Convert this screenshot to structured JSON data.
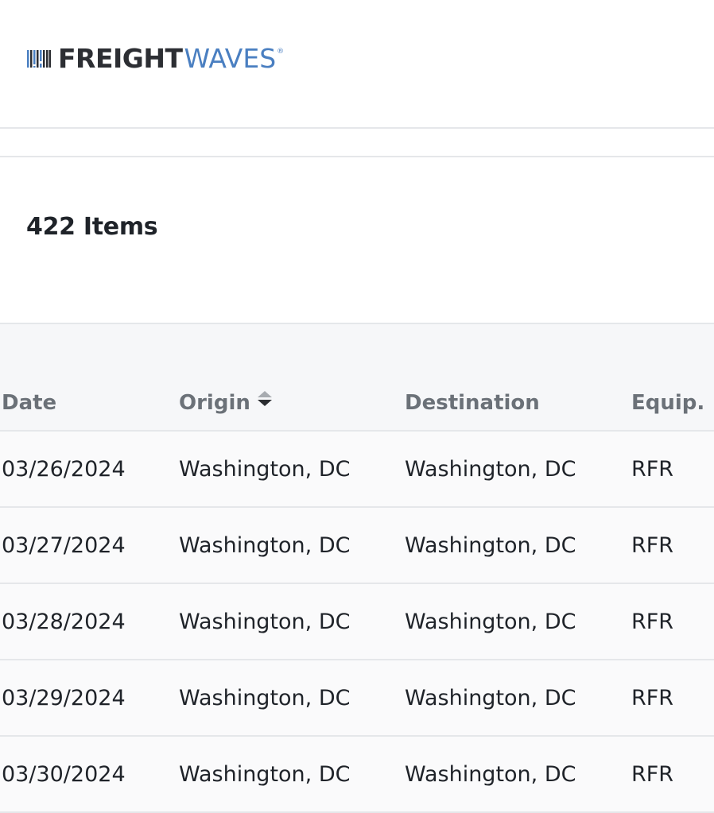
{
  "brand": {
    "name_dark": "FREIGHT",
    "name_blue": "WAVES",
    "registered": "®",
    "color_dark": "#2c2e33",
    "color_blue": "#4a7fc1"
  },
  "results": {
    "count_label": "422 Items"
  },
  "table": {
    "columns": [
      {
        "label": "Date"
      },
      {
        "label": "Origin",
        "sortable": true
      },
      {
        "label": "Destination"
      },
      {
        "label": "Equip."
      }
    ],
    "rows": [
      {
        "date": "03/26/2024",
        "origin": "Washington, DC",
        "destination": "Washington, DC",
        "equip": "RFR"
      },
      {
        "date": "03/27/2024",
        "origin": "Washington, DC",
        "destination": "Washington, DC",
        "equip": "RFR"
      },
      {
        "date": "03/28/2024",
        "origin": "Washington, DC",
        "destination": "Washington, DC",
        "equip": "RFR"
      },
      {
        "date": "03/29/2024",
        "origin": "Washington, DC",
        "destination": "Washington, DC",
        "equip": "RFR"
      },
      {
        "date": "03/30/2024",
        "origin": "Washington, DC",
        "destination": "Washington, DC",
        "equip": "RFR"
      }
    ]
  },
  "icons": {
    "logo_mark": "barcode-waves-icon",
    "sort": "sort-arrows-icon"
  }
}
